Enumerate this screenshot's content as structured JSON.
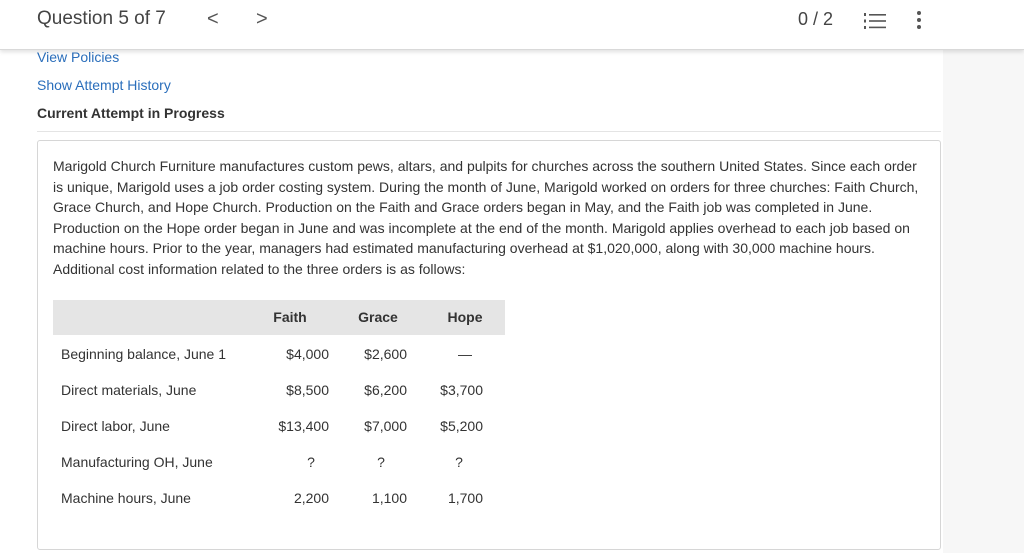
{
  "header": {
    "question_position": "Question 5 of 7",
    "prev_glyph": "<",
    "next_glyph": ">",
    "score": "0 / 2",
    "list_icon": "numbered-list-icon",
    "more_icon": "more-vertical-icon"
  },
  "links": {
    "view_policies": "View Policies",
    "show_attempt_history": "Show Attempt History"
  },
  "attempt_status": "Current Attempt in Progress",
  "problem_text": "Marigold Church Furniture manufactures custom pews, altars, and pulpits for churches across the southern United States. Since each order is unique, Marigold uses a job order costing system. During the month of June, Marigold worked on orders for three churches: Faith Church, Grace Church, and Hope Church. Production on the Faith and Grace orders began in May, and the Faith job was completed in June. Production on the Hope order began in June and was incomplete at the end of the month. Marigold applies overhead to each job based on machine hours. Prior to the year, managers had estimated manufacturing overhead at $1,020,000, along with 30,000 machine hours. Additional cost information related to the three orders is as follows:",
  "table": {
    "headers": [
      "Faith",
      "Grace",
      "Hope"
    ],
    "rows": [
      {
        "label": "Beginning balance, June 1",
        "faith": "$4,000",
        "grace": "$2,600",
        "hope": "—"
      },
      {
        "label": "Direct materials, June",
        "faith": "$8,500",
        "grace": "$6,200",
        "hope": "$3,700"
      },
      {
        "label": "Direct labor, June",
        "faith": "$13,400",
        "grace": "$7,000",
        "hope": "$5,200"
      },
      {
        "label": "Manufacturing OH, June",
        "faith": "?",
        "grace": "?",
        "hope": "?"
      },
      {
        "label": "Machine hours, June",
        "faith": "2,200",
        "grace": "1,100",
        "hope": "1,700"
      }
    ]
  },
  "colors": {
    "link": "#2a6ebb",
    "table_header_bg": "#e5e5e5",
    "text": "#333333"
  }
}
